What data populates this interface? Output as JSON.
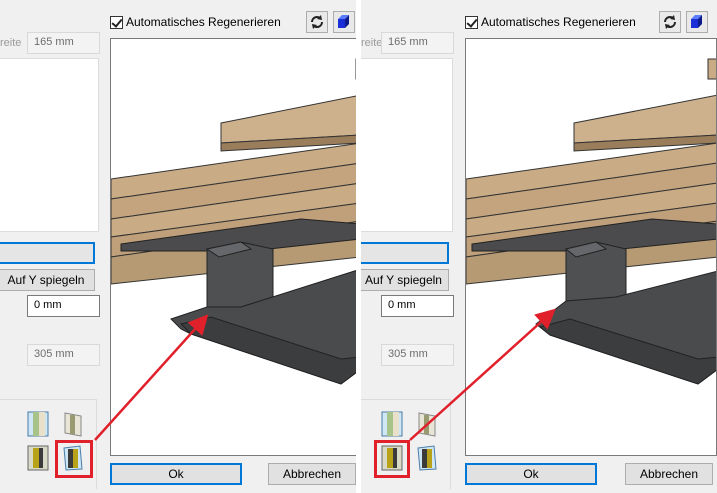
{
  "left": {
    "width_label": "reite",
    "width_value": "165 mm",
    "mirror_y_label": "Auf Y spiegeln",
    "offset_value": "0 mm",
    "length_value": "305 mm",
    "auto_regen_label": "Automatisches Regenerieren",
    "ok_label": "Ok",
    "cancel_label": "Abbrechen"
  },
  "right": {
    "width_label": "reite",
    "width_value": "165 mm",
    "mirror_y_label": "Auf Y spiegeln",
    "offset_value": "0 mm",
    "length_value": "305 mm",
    "auto_regen_label": "Automatisches Regenerieren",
    "ok_label": "Ok",
    "cancel_label": "Abbrechen"
  },
  "icons": {
    "refresh": "refresh-icon",
    "view_cube": "3d-view-icon",
    "profile_options": [
      "profile-option-1-icon",
      "profile-option-2-icon",
      "profile-option-3-icon",
      "profile-option-4-icon"
    ]
  },
  "colors": {
    "highlight_red": "#e0202b",
    "focus_blue": "#0078d7",
    "wood": "#c9ab86",
    "steel": "#4b4b4d"
  }
}
